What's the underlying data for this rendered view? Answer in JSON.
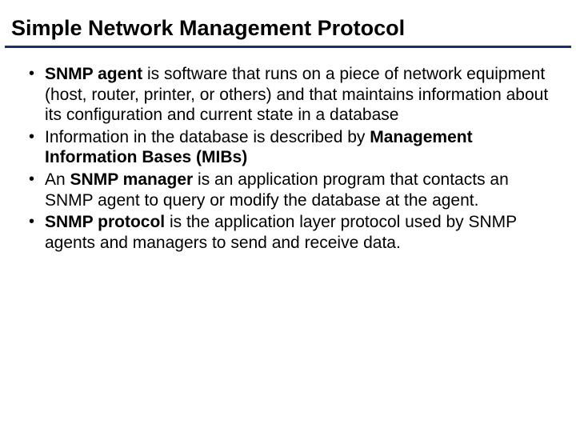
{
  "title": "Simple Network Management Protocol",
  "bullets": [
    {
      "b1": "SNMP agent",
      "t1": " is software that runs on a piece of network equipment (host, router, printer, or others) and that maintains information about its configuration and current state in a database"
    },
    {
      "t0": " Information in the database is described by ",
      "b1": "Management Information Bases (MIBs)"
    },
    {
      "t0": "An ",
      "b1": "SNMP manager",
      "t1": " is an application program that contacts an SNMP agent to query or modify  the database at the agent."
    },
    {
      "b1": "SNMP protocol",
      "t1": " is the application layer protocol used by SNMP agents and managers to send and receive data."
    }
  ]
}
